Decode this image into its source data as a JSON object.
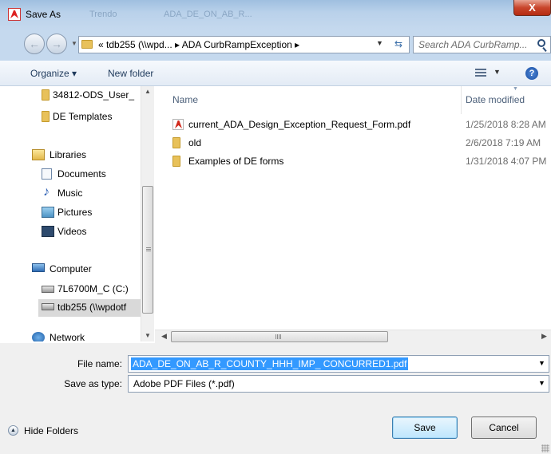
{
  "window": {
    "title": "Save As",
    "ghost_title_left": "Trendo",
    "ghost_title_mid": "ADA_DE_ON_AB_R...",
    "close_label": "X"
  },
  "address": {
    "path": "«  tdb255 (\\\\wpd... ▸ ADA CurbRampException ▸",
    "search_placeholder": "Search ADA CurbRamp..."
  },
  "toolbar": {
    "organize": "Organize ▾",
    "new_folder": "New folder",
    "help": "?"
  },
  "nav": {
    "items": [
      {
        "label": "34812-ODS_User_",
        "icon": "folder-icon"
      },
      {
        "label": "DE Templates",
        "icon": "folder-icon"
      },
      {
        "label": "Libraries",
        "icon": "libraries-icon"
      },
      {
        "label": "Documents",
        "icon": "documents-icon"
      },
      {
        "label": "Music",
        "icon": "music-icon"
      },
      {
        "label": "Pictures",
        "icon": "pictures-icon"
      },
      {
        "label": "Videos",
        "icon": "videos-icon"
      },
      {
        "label": "Computer",
        "icon": "computer-icon"
      },
      {
        "label": "7L6700M_C (C:)",
        "icon": "drive-icon"
      },
      {
        "label": "tdb255 (\\\\wpdotf",
        "icon": "network-drive-icon"
      },
      {
        "label": "Network",
        "icon": "network-icon"
      }
    ]
  },
  "files": {
    "columns": {
      "name": "Name",
      "date": "Date modified"
    },
    "rows": [
      {
        "name": "current_ADA_Design_Exception_Request_Form.pdf",
        "date": "1/25/2018 8:28 AM",
        "icon": "pdf-icon"
      },
      {
        "name": "old",
        "date": "2/6/2018 7:19 AM",
        "icon": "folder-icon"
      },
      {
        "name": "Examples of DE forms",
        "date": "1/31/2018 4:07 PM",
        "icon": "folder-icon"
      }
    ]
  },
  "form": {
    "file_name_label": "File name:",
    "file_name_value": "ADA_DE_ON_AB_R_COUNTY_HHH_IMP_ CONCURRED1.pdf",
    "save_type_label": "Save as type:",
    "save_type_value": "Adobe PDF Files (*.pdf)",
    "hide_folders": "Hide Folders",
    "save": "Save",
    "cancel": "Cancel"
  },
  "colors": {
    "selection": "#3399ff",
    "titlebar": "#b9d1ea",
    "close": "#c9462c"
  }
}
